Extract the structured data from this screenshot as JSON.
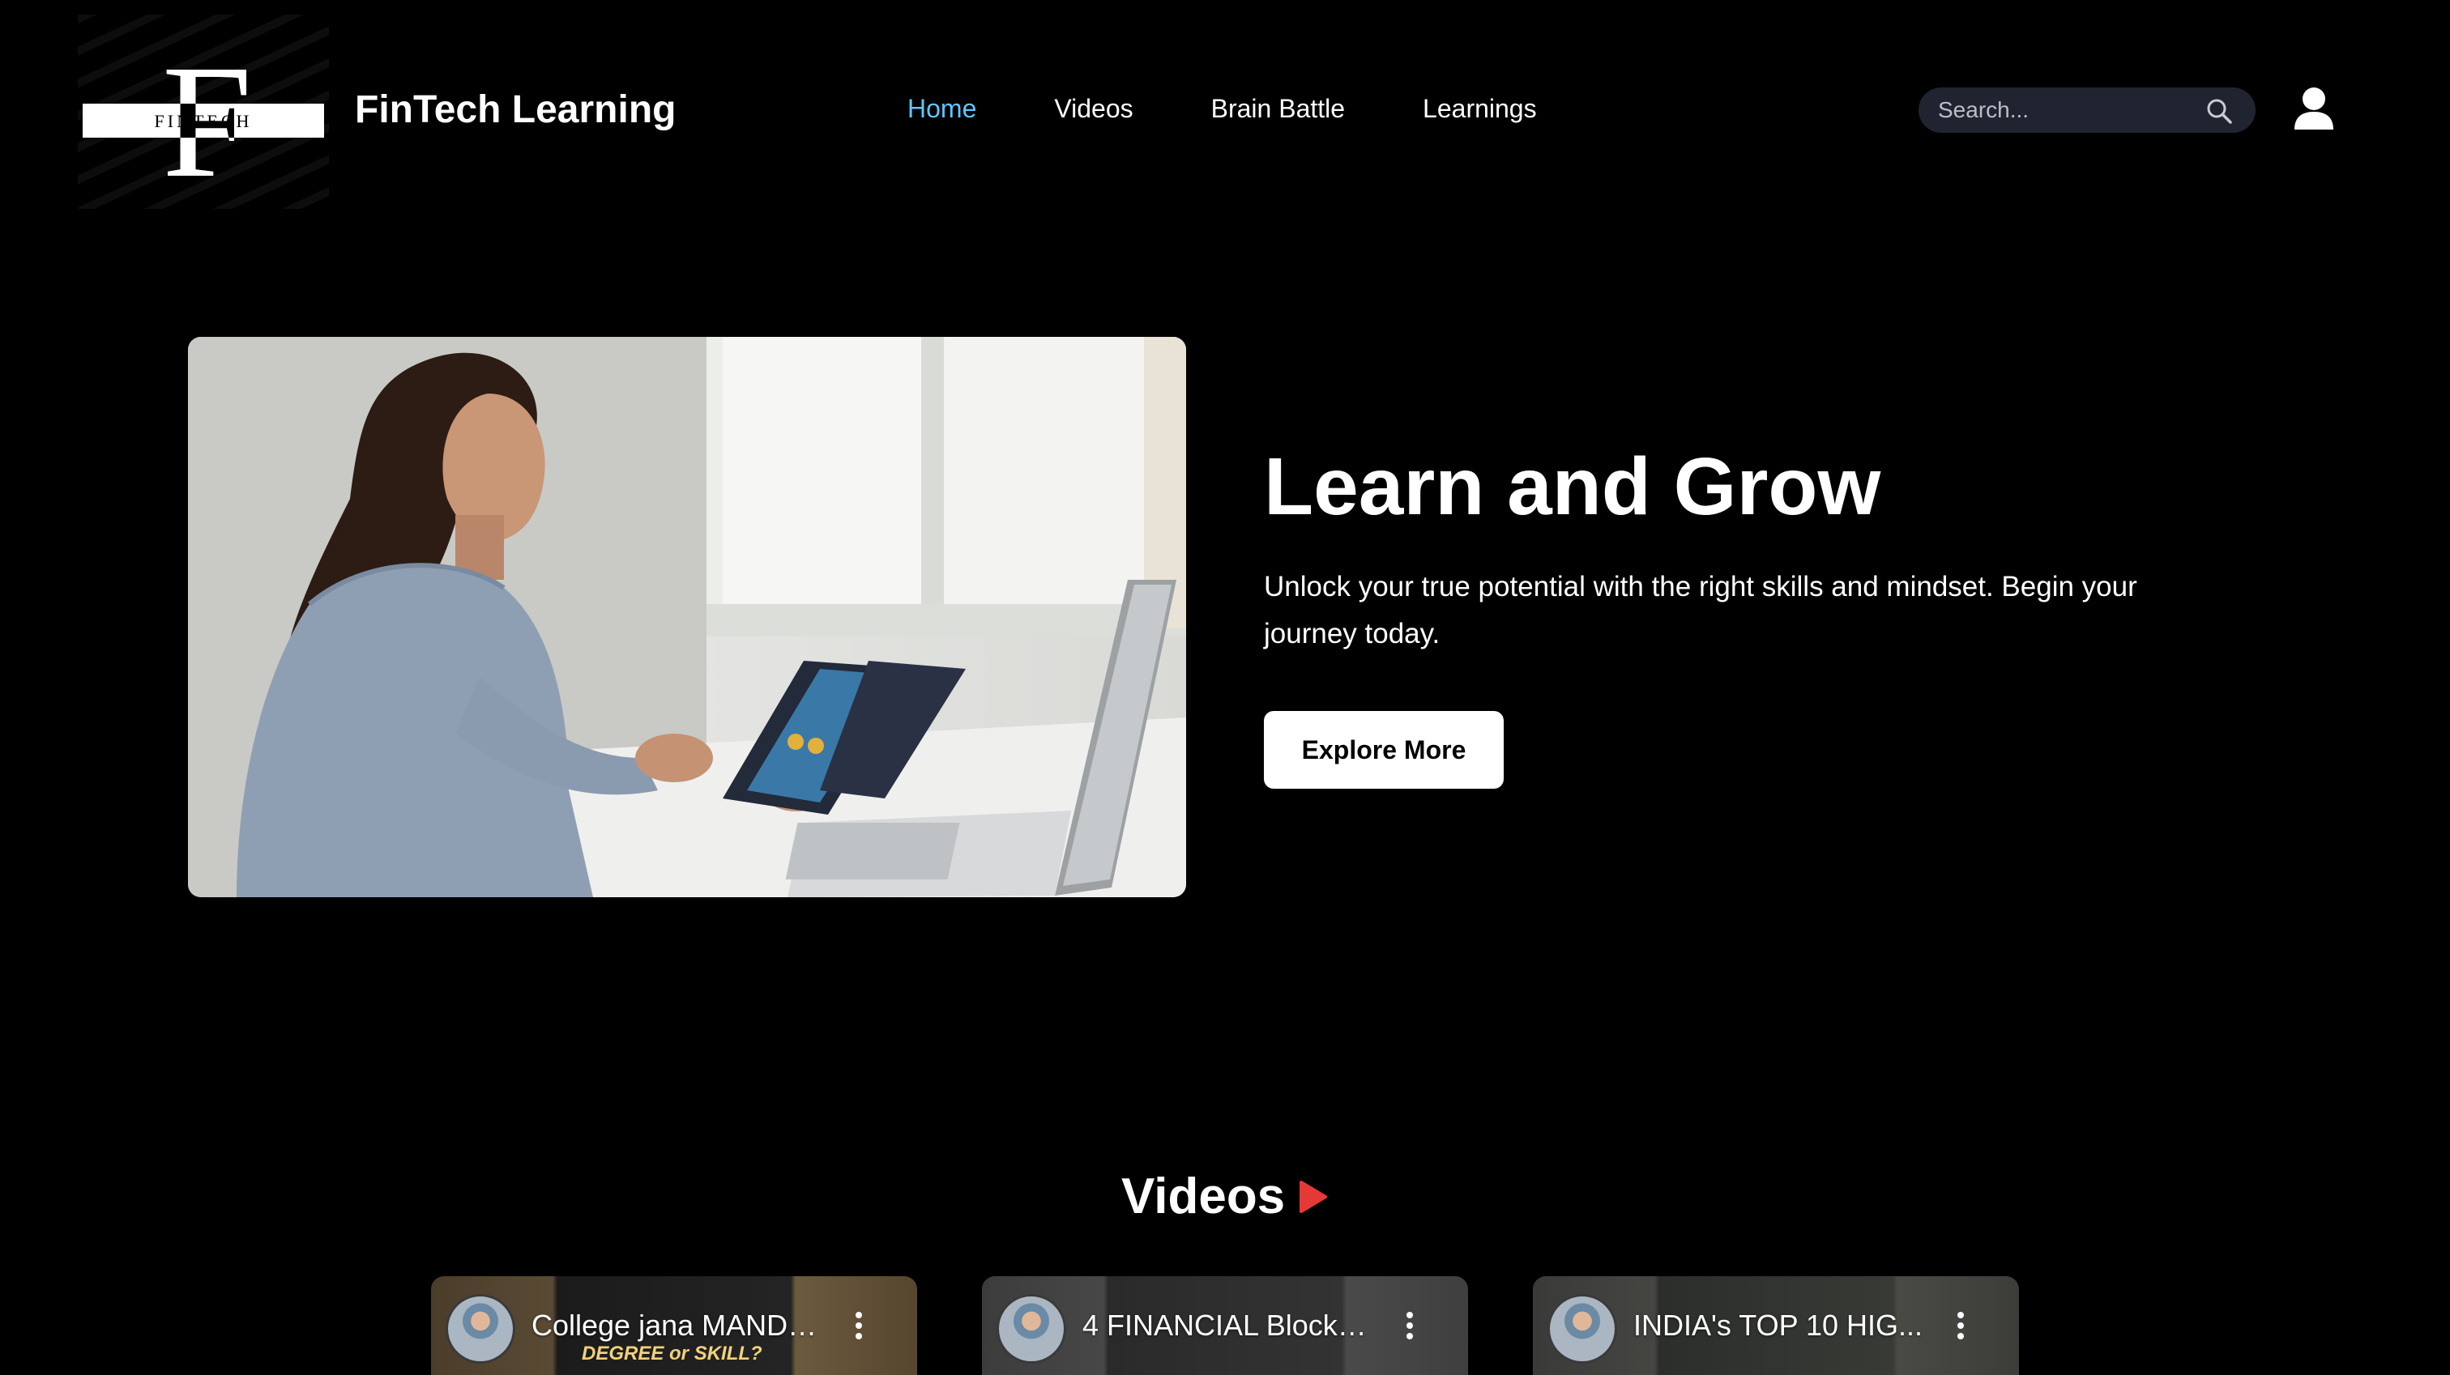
{
  "brand": {
    "logo_letter": "F",
    "logo_word": "FINTECH",
    "name": "FinTech Learning"
  },
  "nav": {
    "items": [
      {
        "label": "Home",
        "active": true
      },
      {
        "label": "Videos",
        "active": false
      },
      {
        "label": "Brain Battle",
        "active": false
      },
      {
        "label": "Learnings",
        "active": false
      }
    ]
  },
  "search": {
    "placeholder": "Search...",
    "value": "",
    "icon": "search-icon"
  },
  "user": {
    "icon": "user-icon"
  },
  "hero": {
    "title": "Learn and Grow",
    "subtitle": "Unlock your true potential with the right skills and mindset. Begin your journey today.",
    "button_label": "Explore More"
  },
  "videos": {
    "heading": "Videos",
    "cards": [
      {
        "title": "College jana MANDA...",
        "overlay_text": "DEGREE or SKILL?"
      },
      {
        "title": "4 FINANCIAL Blockb...",
        "overlay_text": ""
      },
      {
        "title": "INDIA's TOP 10 HIG...",
        "overlay_text": ""
      }
    ]
  },
  "colors": {
    "background": "#000000",
    "nav_active": "#5ec6ff",
    "search_bg": "#1f2430",
    "play_icon": "#e53935"
  }
}
